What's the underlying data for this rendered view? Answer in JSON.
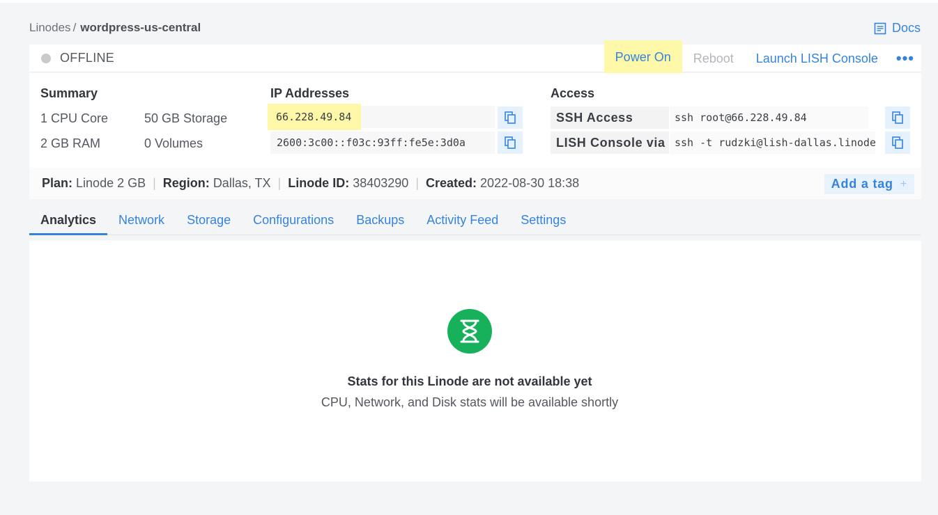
{
  "breadcrumb": {
    "parent": "Linodes",
    "separator": "/",
    "current": "wordpress-us-central"
  },
  "docs": {
    "label": "Docs"
  },
  "status": {
    "label": "OFFLINE",
    "color": "#c9cacb"
  },
  "actions": {
    "power_on": "Power On",
    "reboot": "Reboot",
    "launch_lish": "Launch LISH Console",
    "more": "•••"
  },
  "summary": {
    "title": "Summary",
    "cpu": "1 CPU Core",
    "storage": "50 GB Storage",
    "ram": "2 GB RAM",
    "volumes": "0 Volumes"
  },
  "ip_addresses": {
    "title": "IP Addresses",
    "ipv4": "66.228.49.84",
    "ipv6": "2600:3c00::f03c:93ff:fe5e:3d0a"
  },
  "access": {
    "title": "Access",
    "ssh_label": "SSH Access",
    "ssh_value": "ssh root@66.228.49.84",
    "lish_label": "LISH Console via SSH",
    "lish_value": "ssh -t rudzki@lish-dallas.linode.com wordpress-us-central"
  },
  "meta": {
    "plan_label": "Plan:",
    "plan_value": "Linode 2 GB",
    "region_label": "Region:",
    "region_value": "Dallas, TX",
    "id_label": "Linode ID:",
    "id_value": "38403290",
    "created_label": "Created:",
    "created_value": "2022-08-30 18:38",
    "add_tag": "Add a tag",
    "add_tag_icon": "+"
  },
  "tabs": [
    {
      "label": "Analytics"
    },
    {
      "label": "Network"
    },
    {
      "label": "Storage"
    },
    {
      "label": "Configurations"
    },
    {
      "label": "Backups"
    },
    {
      "label": "Activity Feed"
    },
    {
      "label": "Settings"
    }
  ],
  "empty_state": {
    "icon": "hourglass-icon",
    "title": "Stats for this Linode are not available yet",
    "subtitle": "CPU, Network, and Disk stats will be available shortly"
  },
  "colors": {
    "accent": "#3683dc",
    "highlight": "#fcf8a8",
    "success": "#17b15c"
  }
}
